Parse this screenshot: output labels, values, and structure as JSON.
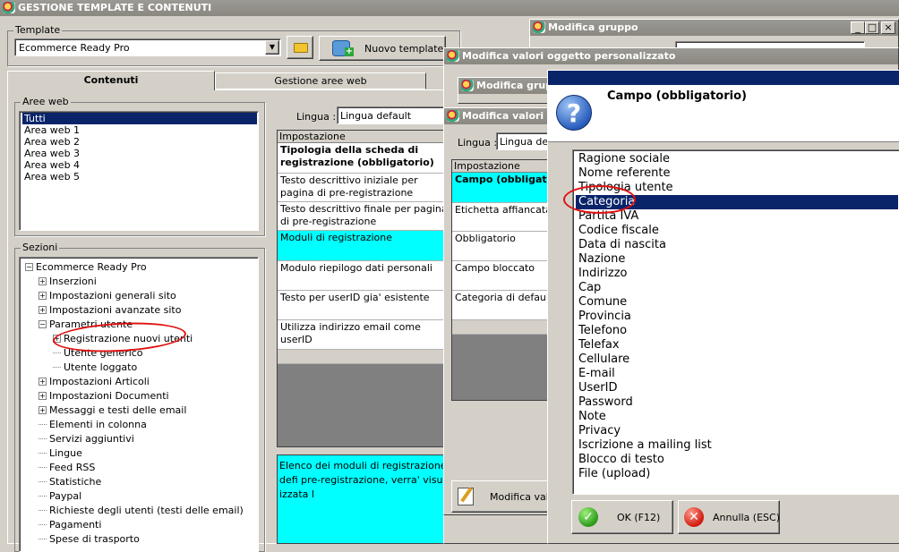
{
  "main_window": {
    "title": "GESTIONE TEMPLATE E CONTENUTI"
  },
  "template": {
    "label": "Template",
    "selected": "Ecommerce Ready Pro",
    "new_button": "Nuovo template"
  },
  "tabs": [
    {
      "label": "Contenuti"
    },
    {
      "label": "Gestione aree web"
    }
  ],
  "aree_web": {
    "label": "Aree web",
    "items": [
      "Tutti",
      "Area web 1",
      "Area web 2",
      "Area web 3",
      "Area web 4",
      "Area web 5"
    ],
    "selected_index": 0
  },
  "sezioni": {
    "label": "Sezioni",
    "items": [
      {
        "label": "Ecommerce Ready Pro",
        "level": 0,
        "toggle": "-"
      },
      {
        "label": "Inserzioni",
        "level": 1,
        "toggle": "+"
      },
      {
        "label": "Impostazioni generali sito",
        "level": 1,
        "toggle": "+"
      },
      {
        "label": "Impostazioni avanzate sito",
        "level": 1,
        "toggle": "+"
      },
      {
        "label": "Parametri utente",
        "level": 1,
        "toggle": "-"
      },
      {
        "label": "Registrazione nuovi utenti",
        "level": 2,
        "toggle": "+"
      },
      {
        "label": "Utente generico",
        "level": 2,
        "toggle": ""
      },
      {
        "label": "Utente loggato",
        "level": 2,
        "toggle": ""
      },
      {
        "label": "Impostazioni Articoli",
        "level": 1,
        "toggle": "+"
      },
      {
        "label": "Impostazioni Documenti",
        "level": 1,
        "toggle": "+"
      },
      {
        "label": "Messaggi e testi delle email",
        "level": 1,
        "toggle": "+"
      },
      {
        "label": "Elementi in colonna",
        "level": 1,
        "toggle": ""
      },
      {
        "label": "Servizi aggiuntivi",
        "level": 1,
        "toggle": ""
      },
      {
        "label": "Lingue",
        "level": 1,
        "toggle": ""
      },
      {
        "label": "Feed RSS",
        "level": 1,
        "toggle": ""
      },
      {
        "label": "Statistiche",
        "level": 1,
        "toggle": ""
      },
      {
        "label": "Paypal",
        "level": 1,
        "toggle": ""
      },
      {
        "label": "Richieste degli utenti (testi delle email)",
        "level": 1,
        "toggle": ""
      },
      {
        "label": "Pagamenti",
        "level": 1,
        "toggle": ""
      },
      {
        "label": "Spese di trasporto",
        "level": 1,
        "toggle": ""
      }
    ]
  },
  "content": {
    "lingua_label": "Lingua :",
    "lingua_value": "Lingua default",
    "grid_header": "Impostazione",
    "rows": [
      "Tipologia della scheda di registrazione (obbligatorio)",
      "Testo descrittivo iniziale per pagina di pre-registrazione",
      "Testo descrittivo finale per pagina di pre-registrazione",
      "Moduli di registrazione",
      "Modulo riepilogo dati personali",
      "Testo per userID gia' esistente",
      "Utilizza indirizzo email come userID"
    ],
    "description": "Elenco dei moduli di registrazione defi pre-registrazione, verra' visualizzata l"
  },
  "dlg_gruppo": {
    "title": "Modifica gruppo",
    "min": "_",
    "max": "□",
    "close": "×"
  },
  "dlg_valori": {
    "title": "Modifica valori oggetto personalizzato"
  },
  "dlg_gruppo2": {
    "title": "Modifica grupp"
  },
  "dlg_valori2": {
    "title": "Modifica valori og",
    "lingua_label": "Lingua :",
    "lingua_value": "Lingua defa",
    "grid_header": "Impostazione",
    "rows": [
      "Campo (obbligat",
      "Etichetta affiancata al",
      "Obbligatorio",
      "Campo bloccato",
      "Categoria di default"
    ],
    "button": "Modifica valo"
  },
  "campo": {
    "title": "Campo (obbligatorio)",
    "selected_index": 2,
    "options": [
      "Ragione sociale",
      "Nome referente",
      "Tipologia utente",
      "Categoria",
      "Partita IVA",
      "Codice fiscale",
      "Data di nascita",
      "Nazione",
      "Indirizzo",
      "Cap",
      "Comune",
      "Provincia",
      "Telefono",
      "Telefax",
      "Cellulare",
      "E-mail",
      "UserID",
      "Password",
      "Note",
      "Privacy",
      "Iscrizione a mailing list",
      "Blocco di testo",
      "File (upload)"
    ],
    "ok_label": "OK (F12)",
    "cancel_label": "Annulla (ESC)"
  },
  "colors": {
    "title_bar": "#8a8880",
    "selection": "#0a246a",
    "highlight": "#00ffff",
    "annotation": "#e01010"
  }
}
